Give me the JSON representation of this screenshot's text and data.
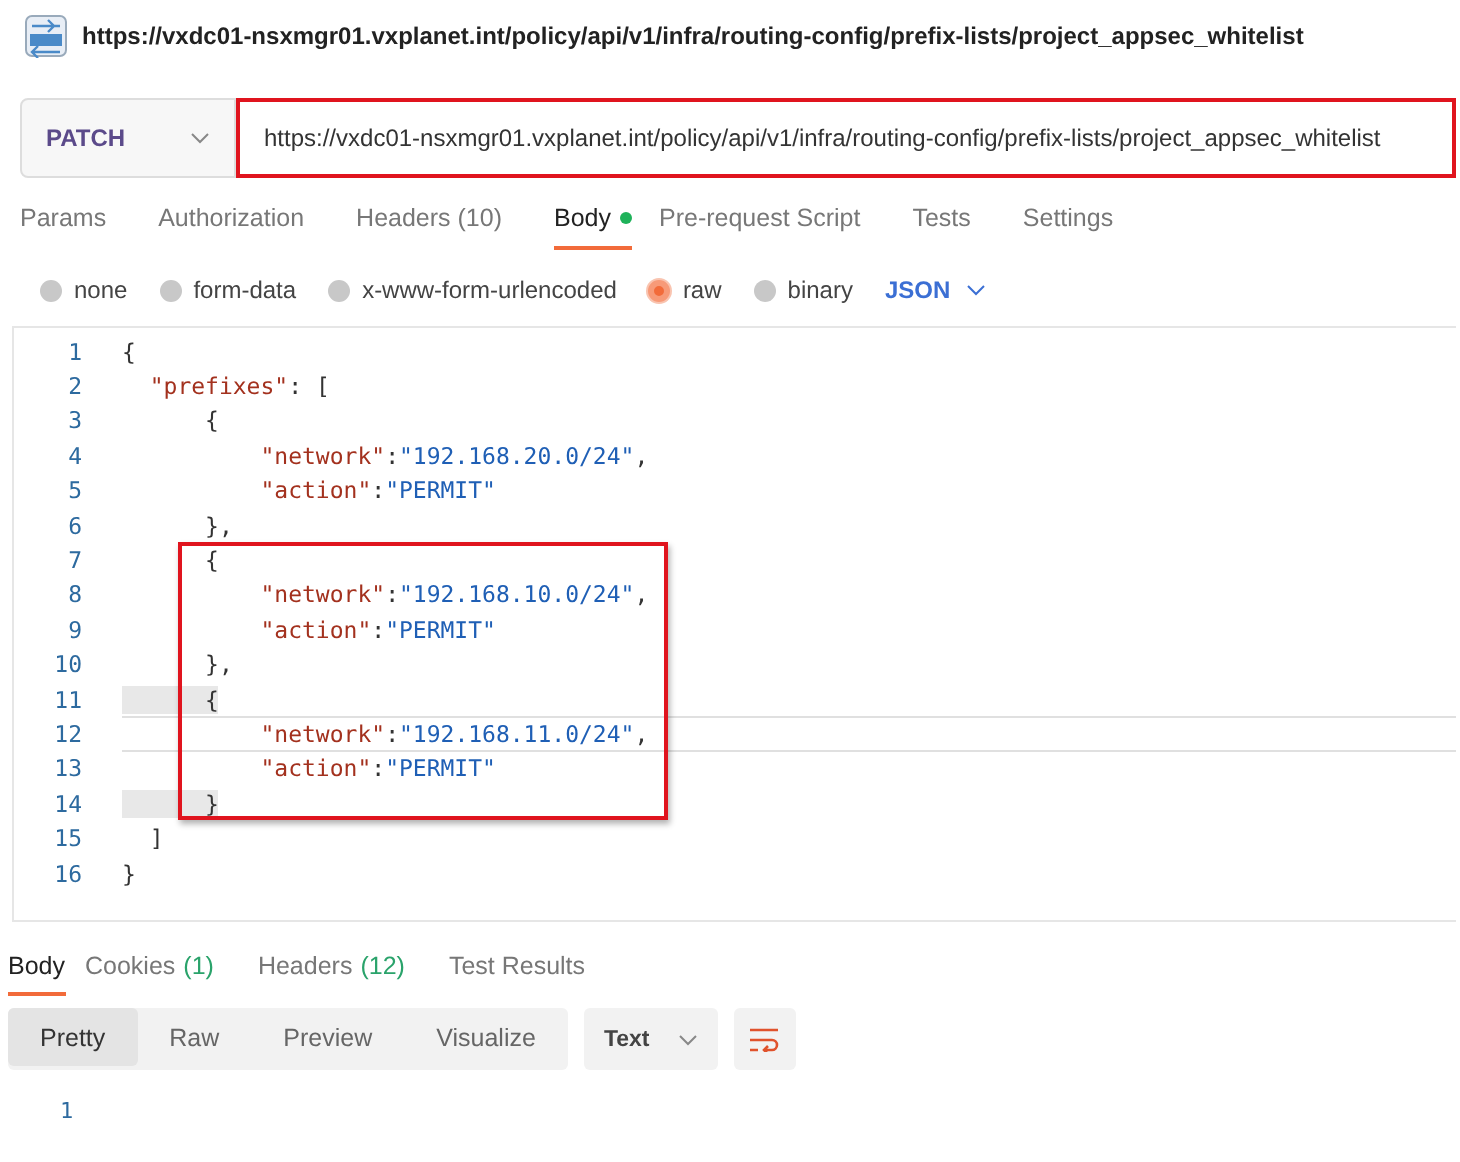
{
  "request_title": "https://vxdc01-nsxmgr01.vxplanet.int/policy/api/v1/infra/routing-config/prefix-lists/project_appsec_whitelist",
  "method": "PATCH",
  "url": {
    "value": "https://vxdc01-nsxmgr01.vxplanet.int/policy/api/v1/infra/routing-config/prefix-lists/project_appsec_whitelist",
    "highlighted": true
  },
  "request_tabs": [
    {
      "label": "Params",
      "selected": false,
      "dot": false
    },
    {
      "label": "Authorization",
      "selected": false,
      "dot": false
    },
    {
      "label": "Headers (10)",
      "selected": false,
      "dot": false
    },
    {
      "label": "Body",
      "selected": true,
      "dot": true
    },
    {
      "label": "Pre-request Script",
      "selected": false,
      "dot": false
    },
    {
      "label": "Tests",
      "selected": false,
      "dot": false
    },
    {
      "label": "Settings",
      "selected": false,
      "dot": false
    }
  ],
  "body_types": [
    {
      "label": "none",
      "selected": false
    },
    {
      "label": "form-data",
      "selected": false
    },
    {
      "label": "x-www-form-urlencoded",
      "selected": false
    },
    {
      "label": "raw",
      "selected": true
    },
    {
      "label": "binary",
      "selected": false
    }
  ],
  "format": "JSON",
  "code_sections": [
    {
      "highlighted": false,
      "lines": [
        {
          "number": "1",
          "current": false,
          "tokens": [
            {
              "kind": "punct",
              "text": "{"
            }
          ]
        },
        {
          "number": "2",
          "current": false,
          "tokens": [
            {
              "kind": "key",
              "text": "  \"prefixes\""
            },
            {
              "kind": "punct",
              "text": ": ["
            }
          ]
        },
        {
          "number": "3",
          "current": false,
          "tokens": [
            {
              "kind": "punct",
              "text": "      {"
            }
          ]
        },
        {
          "number": "4",
          "current": false,
          "tokens": [
            {
              "kind": "key",
              "text": "          \"network\""
            },
            {
              "kind": "punct",
              "text": ":"
            },
            {
              "kind": "string",
              "text": "\"192.168.20.0/24\""
            },
            {
              "kind": "punct",
              "text": ","
            }
          ]
        },
        {
          "number": "5",
          "current": false,
          "tokens": [
            {
              "kind": "key",
              "text": "          \"action\""
            },
            {
              "kind": "punct",
              "text": ":"
            },
            {
              "kind": "string",
              "text": "\"PERMIT\""
            }
          ]
        },
        {
          "number": "6",
          "current": false,
          "tokens": [
            {
              "kind": "punct",
              "text": "      },"
            }
          ]
        }
      ]
    },
    {
      "highlighted": true,
      "lines": [
        {
          "number": "7",
          "current": false,
          "tokens": [
            {
              "kind": "punct",
              "text": "      {"
            }
          ]
        },
        {
          "number": "8",
          "current": false,
          "tokens": [
            {
              "kind": "key",
              "text": "          \"network\""
            },
            {
              "kind": "punct",
              "text": ":"
            },
            {
              "kind": "string",
              "text": "\"192.168.10.0/24\""
            },
            {
              "kind": "punct",
              "text": ","
            }
          ]
        },
        {
          "number": "9",
          "current": false,
          "tokens": [
            {
              "kind": "key",
              "text": "          \"action\""
            },
            {
              "kind": "punct",
              "text": ":"
            },
            {
              "kind": "string",
              "text": "\"PERMIT\""
            }
          ]
        },
        {
          "number": "10",
          "current": false,
          "tokens": [
            {
              "kind": "punct",
              "text": "      },"
            }
          ]
        },
        {
          "number": "11",
          "current": false,
          "tokens": [
            {
              "kind": "match",
              "text": "      {"
            }
          ]
        },
        {
          "number": "12",
          "current": true,
          "tokens": [
            {
              "kind": "key",
              "text": "          \"network\""
            },
            {
              "kind": "punct",
              "text": ":"
            },
            {
              "kind": "string",
              "text": "\"192.168.11.0/24\""
            },
            {
              "kind": "punct",
              "text": ","
            }
          ]
        },
        {
          "number": "13",
          "current": false,
          "tokens": [
            {
              "kind": "key",
              "text": "          \"action\""
            },
            {
              "kind": "punct",
              "text": ":"
            },
            {
              "kind": "string",
              "text": "\"PERMIT\""
            }
          ]
        },
        {
          "number": "14",
          "current": false,
          "tokens": [
            {
              "kind": "match",
              "text": "      }"
            }
          ]
        }
      ]
    },
    {
      "highlighted": false,
      "lines": [
        {
          "number": "15",
          "current": false,
          "tokens": [
            {
              "kind": "punct",
              "text": "  ]"
            }
          ]
        },
        {
          "number": "16",
          "current": false,
          "tokens": [
            {
              "kind": "punct",
              "text": "}"
            }
          ]
        }
      ]
    }
  ],
  "response_tabs": [
    {
      "label": "Body",
      "selected": true
    },
    {
      "label": "Cookies",
      "count": "(1)",
      "selected": false
    },
    {
      "label": "Headers",
      "count": "(12)",
      "selected": false
    },
    {
      "label": "Test Results",
      "selected": false
    }
  ],
  "view_modes": [
    {
      "label": "Pretty",
      "selected": true
    },
    {
      "label": "Raw",
      "selected": false
    },
    {
      "label": "Preview",
      "selected": false
    },
    {
      "label": "Visualize",
      "selected": false
    }
  ],
  "response_format": "Text",
  "response_lines": [
    "1"
  ]
}
